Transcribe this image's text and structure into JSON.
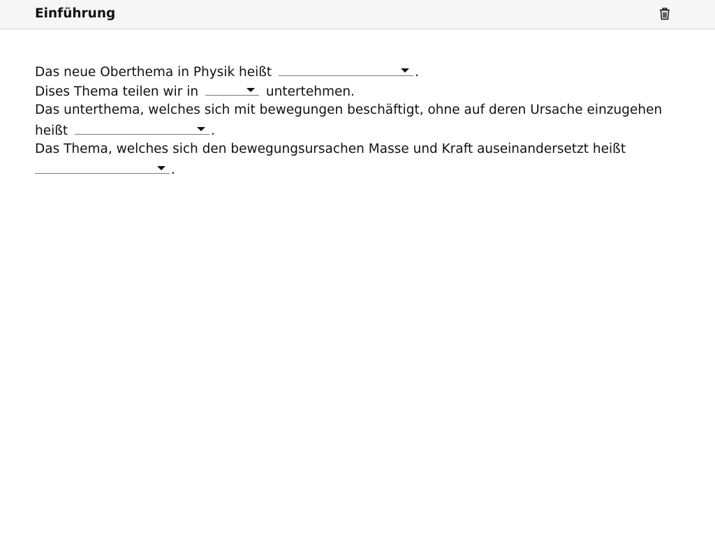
{
  "header": {
    "title": "Einführung",
    "delete_icon": "trash-icon"
  },
  "quiz": {
    "line1": {
      "before": "Das neue Oberthema in Physik heißt",
      "after": "."
    },
    "line2": {
      "before": "Dises Thema teilen wir in",
      "after": "untertehmen."
    },
    "line3": {
      "before": "Das unterthema, welches sich mit bewegungen beschäftigt, ohne auf deren Ursache einzugehen"
    },
    "line4": {
      "before": "heißt",
      "after": "."
    },
    "line5": {
      "before": "Das Thema, welches sich den bewegungsursachen Masse und Kraft auseinandersetzt heißt"
    },
    "line6": {
      "after": "."
    },
    "dropdowns": [
      {
        "selected": ""
      },
      {
        "selected": ""
      },
      {
        "selected": ""
      },
      {
        "selected": ""
      }
    ]
  }
}
